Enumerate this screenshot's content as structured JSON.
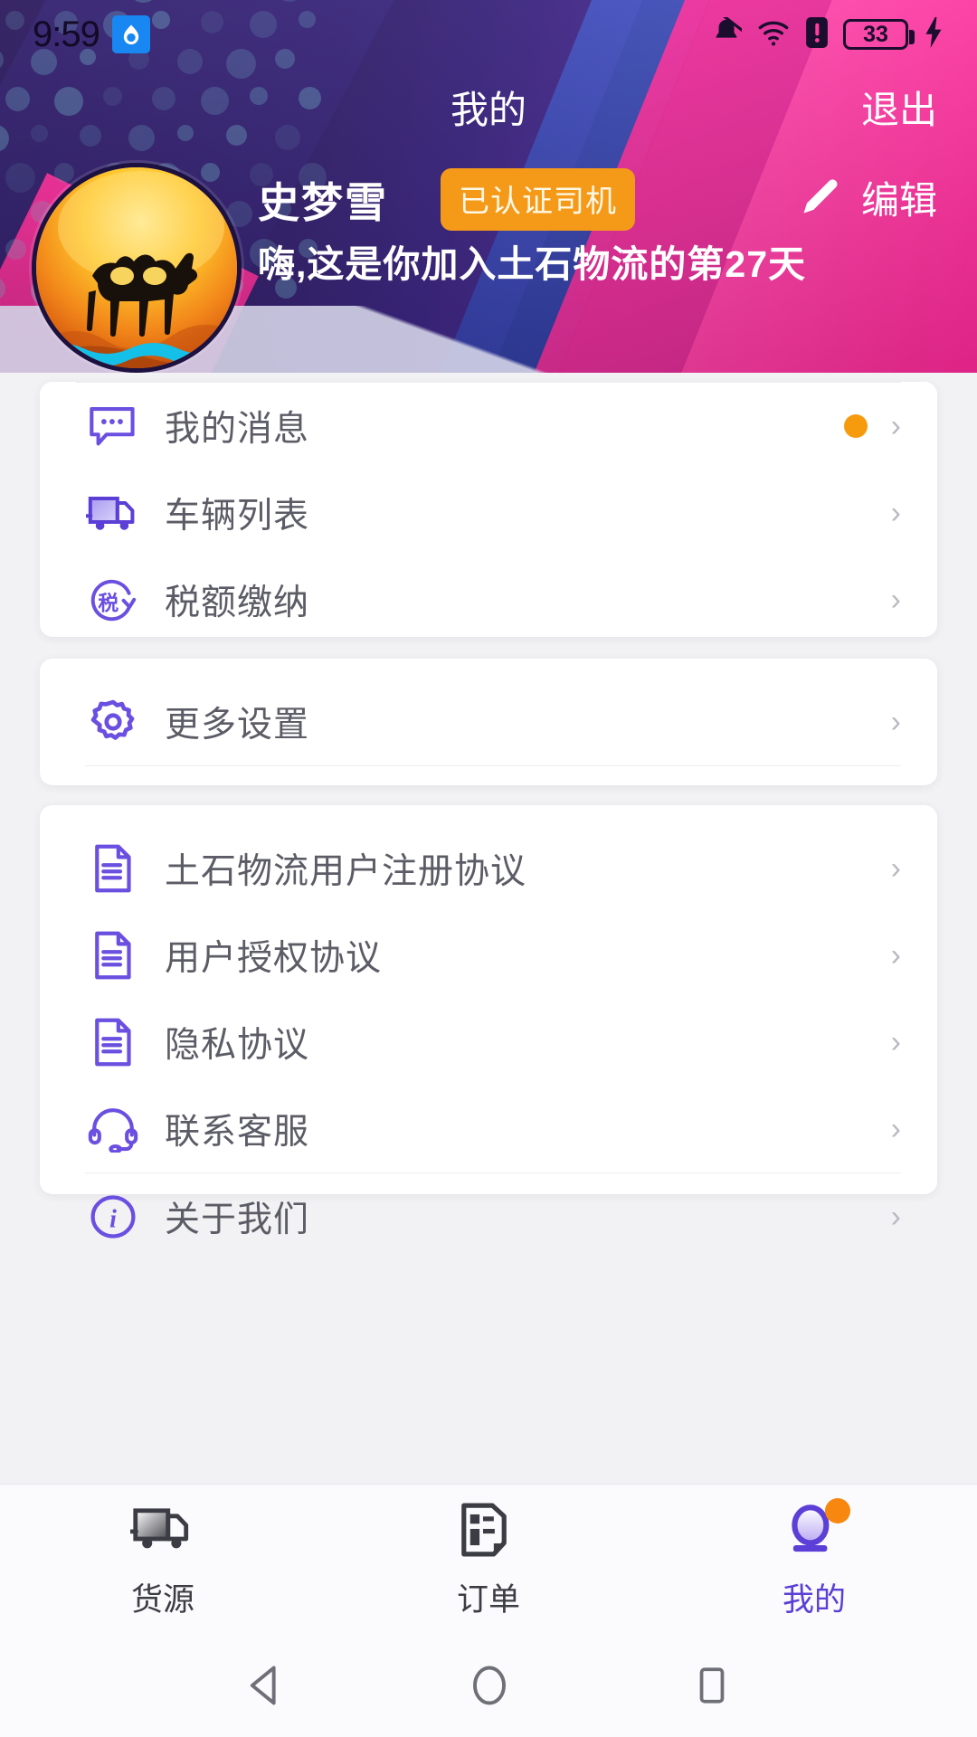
{
  "status_bar": {
    "time": "9:59",
    "app_icon": "droplet-icon",
    "icons": [
      "bell-muted-icon",
      "wifi-icon",
      "sim-alert-icon",
      "battery-icon",
      "charging-bolt-icon"
    ],
    "battery_level": "33"
  },
  "header": {
    "title": "我的",
    "logout_label": "退出"
  },
  "profile": {
    "avatar_alt": "camel-avatar",
    "name": "史梦雪",
    "certification_badge": "已认证司机",
    "subtitle": "嗨,这是你加入土石物流的第27天",
    "edit_label": "编辑",
    "edit_icon": "pencil-icon"
  },
  "cards": {
    "main": [
      {
        "icon": "message-bubble-icon",
        "label": "我的消息",
        "badge": true,
        "chevron": "›"
      },
      {
        "icon": "truck-icon",
        "label": "车辆列表",
        "badge": false,
        "chevron": "›"
      },
      {
        "icon": "tax-circle-icon",
        "label": "税额缴纳",
        "badge": false,
        "chevron": "›"
      }
    ],
    "more": [
      {
        "icon": "gear-icon",
        "label": "更多设置",
        "badge": false,
        "chevron": "›"
      }
    ],
    "documents": [
      {
        "icon": "document-icon",
        "label": "土石物流用户注册协议",
        "badge": false,
        "chevron": "›"
      },
      {
        "icon": "document-icon",
        "label": "用户授权协议",
        "badge": false,
        "chevron": "›"
      },
      {
        "icon": "document-icon",
        "label": "隐私协议",
        "badge": false,
        "chevron": "›"
      },
      {
        "icon": "headset-icon",
        "label": "联系客服",
        "badge": false,
        "chevron": "›"
      },
      {
        "icon": "info-circle-icon",
        "label": "关于我们",
        "badge": false,
        "chevron": "›"
      }
    ]
  },
  "bottom_nav": [
    {
      "icon": "truck-icon",
      "label": "货源",
      "active": false,
      "badge": false
    },
    {
      "icon": "order-document-icon",
      "label": "订单",
      "active": false,
      "badge": false
    },
    {
      "icon": "person-icon",
      "label": "我的",
      "active": true,
      "badge": true
    }
  ],
  "system_nav": [
    "back-triangle-icon",
    "home-circle-icon",
    "recents-square-icon"
  ],
  "colors": {
    "accent_purple": "#5b3fd6",
    "badge_orange": "#f79b0e",
    "cert_orange": "#f59a18",
    "hero_pink": "#ff2f9d",
    "hero_purple": "#2d1b5e",
    "label_gray": "#5c5c66"
  }
}
